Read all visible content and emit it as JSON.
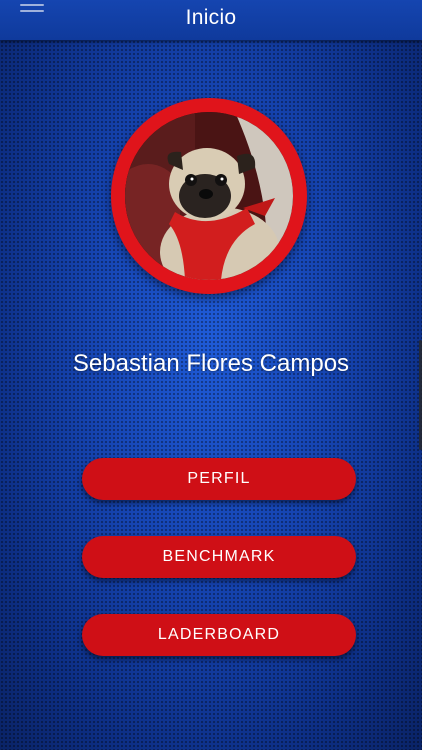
{
  "appbar": {
    "title": "Inicio",
    "menu_icon": "hamburger-menu-icon"
  },
  "profile": {
    "name": "Sebastian Flores Campos",
    "avatar_description": "pug"
  },
  "buttons": [
    {
      "label": "PERFIL"
    },
    {
      "label": "BENCHMARK"
    },
    {
      "label": "LADERBOARD"
    }
  ],
  "colors": {
    "primary_blue": "#1645b3",
    "accent_red": "#cf0f16",
    "text": "#ffffff"
  }
}
